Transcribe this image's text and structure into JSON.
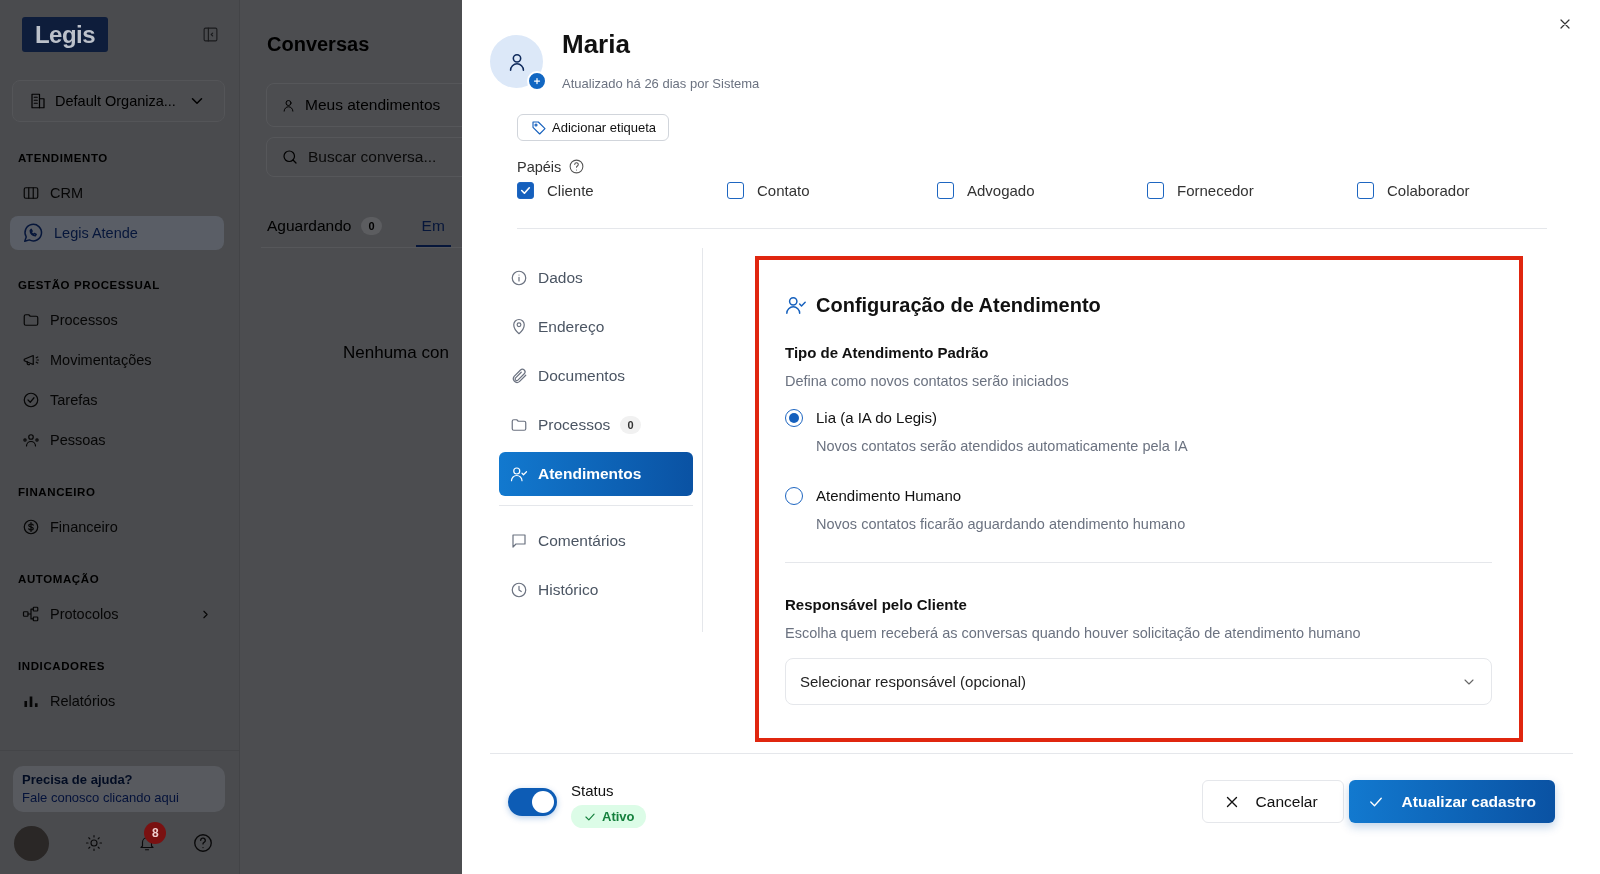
{
  "sidebar": {
    "logo": "Legis",
    "organization": "Default Organiza...",
    "sections": [
      {
        "heading": "ATENDIMENTO",
        "items": [
          {
            "label": "CRM",
            "selected": false,
            "submenu": false
          },
          {
            "label": "Legis Atende",
            "selected": true,
            "submenu": false
          }
        ]
      },
      {
        "heading": "GESTÃO PROCESSUAL",
        "items": [
          {
            "label": "Processos",
            "selected": false,
            "submenu": false
          },
          {
            "label": "Movimentações",
            "selected": false,
            "submenu": false
          },
          {
            "label": "Tarefas",
            "selected": false,
            "submenu": false
          },
          {
            "label": "Pessoas",
            "selected": false,
            "submenu": false
          }
        ]
      },
      {
        "heading": "FINANCEIRO",
        "items": [
          {
            "label": "Financeiro",
            "selected": false,
            "submenu": false
          }
        ]
      },
      {
        "heading": "AUTOMAÇÃO",
        "items": [
          {
            "label": "Protocolos",
            "selected": false,
            "submenu": true
          }
        ]
      },
      {
        "heading": "INDICADORES",
        "items": [
          {
            "label": "Relatórios",
            "selected": false,
            "submenu": false
          }
        ]
      }
    ],
    "help": {
      "title": "Precisa de ajuda?",
      "link": "Fale conosco clicando aqui"
    },
    "notifications": "8"
  },
  "conversations": {
    "title": "Conversas",
    "filter": "Meus atendimentos",
    "search": {
      "placeholder": "Buscar conversa..."
    },
    "tabs": [
      {
        "label": "Aguardando",
        "count": "0",
        "selected": false
      },
      {
        "label": "Em",
        "selected": true
      }
    ],
    "empty_message": "Nenhuma con"
  },
  "contact": {
    "name": "Maria",
    "updated": "Atualizado há 26 dias por Sistema",
    "tag_button": "Adicionar etiqueta",
    "roles_label": "Papéis",
    "roles": [
      {
        "label": "Cliente",
        "checked": true
      },
      {
        "label": "Contato",
        "checked": false
      },
      {
        "label": "Advogado",
        "checked": false
      },
      {
        "label": "Fornecedor",
        "checked": false
      },
      {
        "label": "Colaborador",
        "checked": false
      }
    ],
    "nav_groups": [
      {
        "items": [
          {
            "label": "Dados",
            "selected": false
          },
          {
            "label": "Endereço",
            "selected": false
          },
          {
            "label": "Documentos",
            "selected": false
          },
          {
            "label": "Processos",
            "count": "0",
            "selected": false
          },
          {
            "label": "Atendimentos",
            "selected": true
          }
        ]
      },
      {
        "items": [
          {
            "label": "Comentários",
            "selected": false
          },
          {
            "label": "Histórico",
            "selected": false
          }
        ]
      }
    ],
    "attendance": {
      "title": "Configuração de Atendimento",
      "default_type": {
        "heading": "Tipo de Atendimento Padrão",
        "description": "Defina como novos contatos serão iniciados",
        "options": [
          {
            "label": "Lia (a IA do Legis)",
            "description": "Novos contatos serão atendidos automaticamente pela IA",
            "selected": true
          },
          {
            "label": "Atendimento Humano",
            "description": "Novos contatos ficarão aguardando atendimento humano",
            "selected": false
          }
        ]
      },
      "responsible": {
        "heading": "Responsável pelo Cliente",
        "description": "Escolha quem receberá as conversas quando houver solicitação de atendimento humano",
        "placeholder": "Selecionar responsável (opcional)"
      }
    },
    "status": {
      "label": "Status",
      "on": true,
      "badge": "Ativo"
    },
    "buttons": [
      {
        "label": "Cancelar",
        "kind": "secondary"
      },
      {
        "label": "Atualizar cadastro",
        "kind": "primary"
      }
    ]
  }
}
